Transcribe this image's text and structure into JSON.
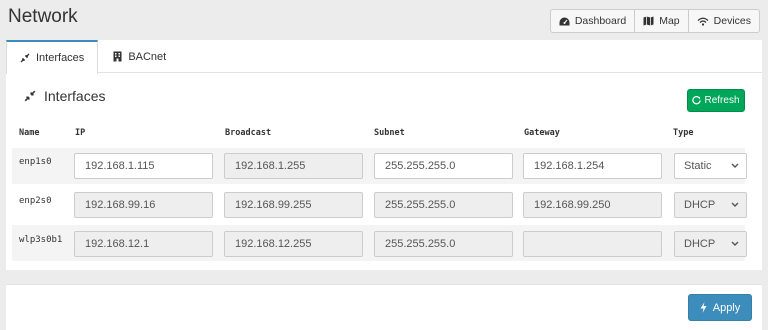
{
  "page": {
    "title": "Network"
  },
  "topnav": {
    "items": [
      {
        "label": "Dashboard",
        "icon": "dashboard-icon"
      },
      {
        "label": "Map",
        "icon": "map-icon"
      },
      {
        "label": "Devices",
        "icon": "wifi-icon"
      }
    ]
  },
  "tabs": [
    {
      "label": "Interfaces",
      "icon": "compress-icon",
      "active": true
    },
    {
      "label": "BACnet",
      "icon": "building-icon",
      "active": false
    }
  ],
  "section": {
    "title": "Interfaces",
    "icon": "compress-icon"
  },
  "refresh": {
    "label": "Refresh",
    "color": "#00a65a"
  },
  "table": {
    "columns": [
      "Name",
      "IP",
      "Broadcast",
      "Subnet",
      "Gateway",
      "Type"
    ],
    "rows": [
      {
        "name": "enp1s0",
        "ip": "192.168.1.115",
        "broadcast": "192.168.1.255",
        "subnet": "255.255.255.0",
        "gateway": "192.168.1.254",
        "type": "Static"
      },
      {
        "name": "enp2s0",
        "ip": "192.168.99.16",
        "broadcast": "192.168.99.255",
        "subnet": "255.255.255.0",
        "gateway": "192.168.99.250",
        "type": "DHCP"
      },
      {
        "name": "wlp3s0b1",
        "ip": "192.168.12.1",
        "broadcast": "192.168.12.255",
        "subnet": "255.255.255.0",
        "gateway": "",
        "type": "DHCP"
      }
    ]
  },
  "footer": {
    "apply_label": "Apply",
    "apply_color": "#3c8dbc"
  }
}
